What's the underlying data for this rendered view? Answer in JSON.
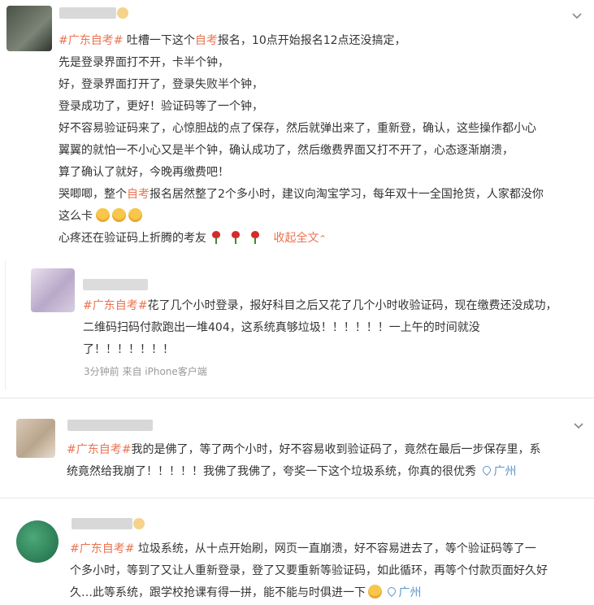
{
  "post": {
    "hashtag": "#广东自考#",
    "line1": {
      "a": " 吐槽一下这个",
      "hl": "自考",
      "b": "报名，10点开始报名12点还没搞定，"
    },
    "line2": "先是登录界面打不开，卡半个钟，",
    "line3": "好，登录界面打开了，登录失败半个钟，",
    "line4": "登录成功了，更好！验证码等了一个钟，",
    "line5": "好不容易验证码来了，心惊胆战的点了保存，然后就弹出来了，重新登，确认，这些操作都小心",
    "line6": "翼翼的就怕一不小心又是半个钟，确认成功了，然后缴费界面又打不开了，心态逐渐崩溃，",
    "line7": "算了确认了就好，今晚再缴费吧！",
    "line8": {
      "a": "哭唧唧，整个",
      "hl": "自考",
      "b": "报名居然整了2个多小时，建议向淘宝学习，每年双十一全国抢货，人家都没你"
    },
    "line9": "这么卡",
    "line10": "心疼还在验证码上折腾的考友",
    "collapse_label": "收起全文",
    "chevron_glyph": "⌄"
  },
  "comment1": {
    "hashtag": "#广东自考#",
    "line1": "花了几个小时登录，报好科目之后又花了几个小时收验证码，现在缴费还没成功，",
    "line2": "二维码扫码付款跑出一堆404，这系统真够垃圾！！！！！！一上午的时间就没",
    "line3": "了！！！！！！！",
    "meta": "3分钟前  来自 iPhone客户端"
  },
  "comment2": {
    "hashtag": "#广东自考#",
    "line1": "我的是佛了，等了两个小时，好不容易收到验证码了，竟然在最后一步保存里，系",
    "line2": "统竟然给我崩了！！！！！我佛了我佛了，夸奖一下这个垃圾系统，你真的很优秀",
    "location": "广州"
  },
  "comment3": {
    "hashtag": "#广东自考#",
    "line1": " 垃圾系统，从十点开始刷，网页一直崩溃，好不容易进去了，等个验证码等了一",
    "line2": "个多小时，等到了又让人重新登录，登了又要重新等验证码，如此循环，再等个付款页面好久好",
    "line3": "久…此等系统，跟学校抢课有得一拼，能不能与时俱进一下",
    "location": "广州"
  },
  "colors": {
    "accent": "#eb7350",
    "link": "#5d95c8",
    "text": "#333333",
    "meta": "#999999"
  }
}
